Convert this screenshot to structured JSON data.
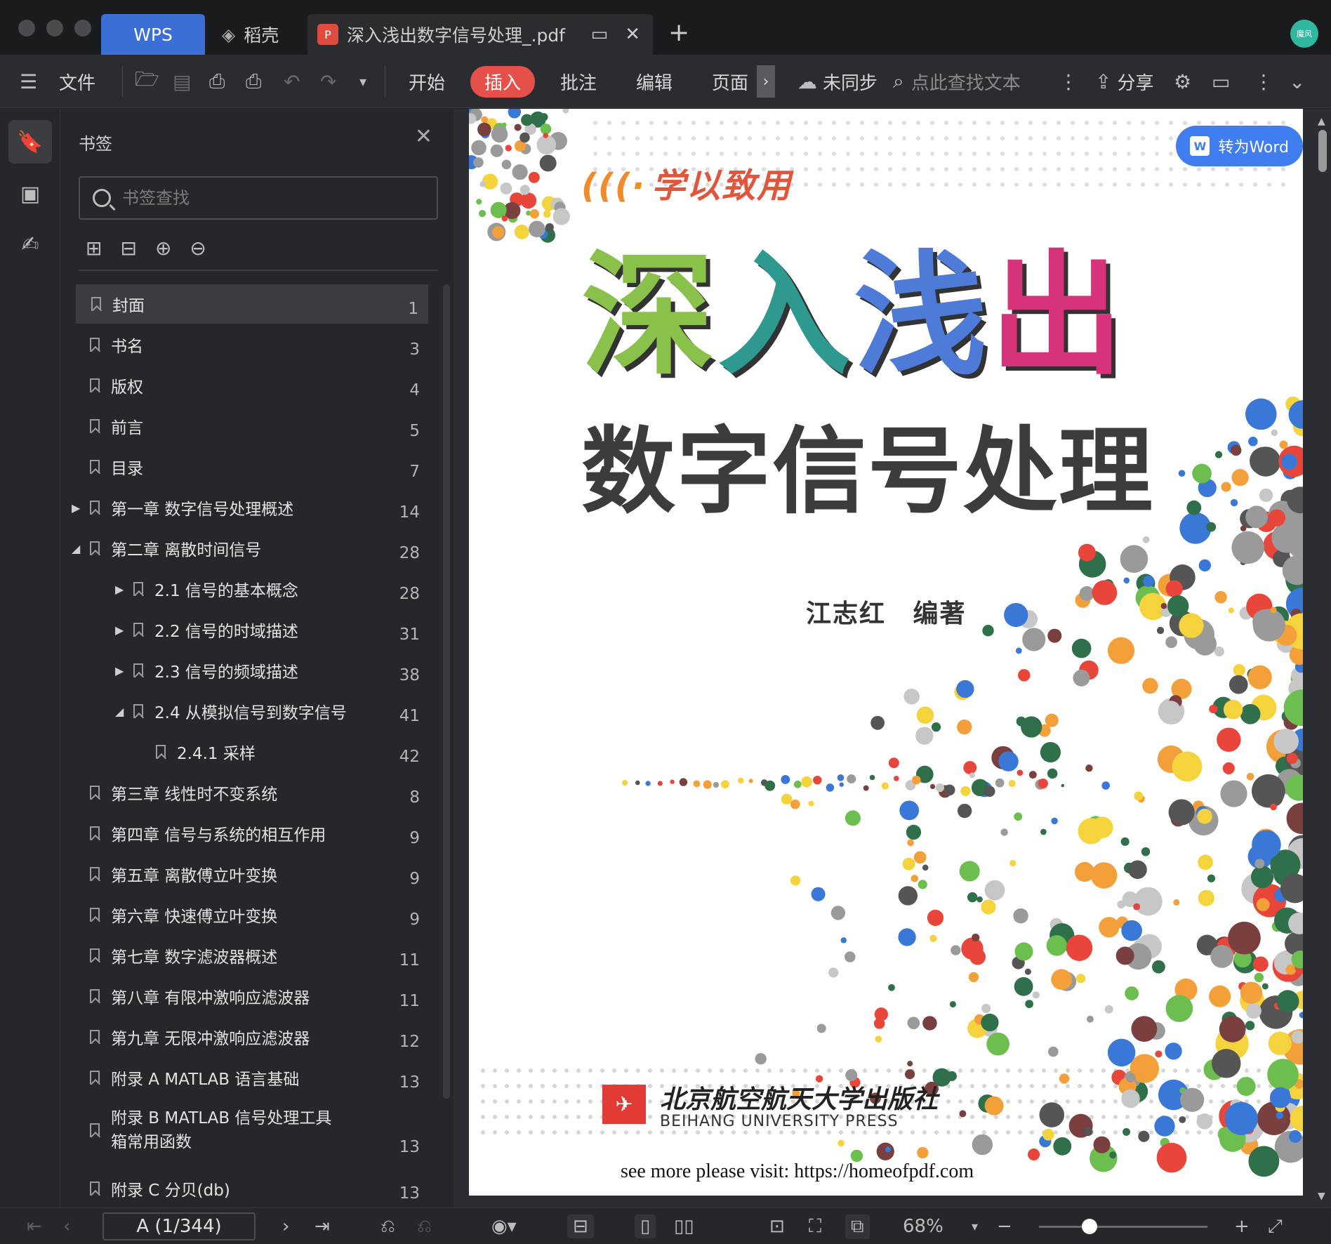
{
  "tabs": {
    "wps": "WPS",
    "daoke": "稻壳",
    "doc": "深入浅出数字信号处理_.pdf"
  },
  "avatar_text": "魔风",
  "toolbar": {
    "file": "文件",
    "start": "开始",
    "insert": "插入",
    "comment": "批注",
    "edit": "编辑",
    "page": "页面",
    "sync": "未同步",
    "find": "点此查找文本",
    "share": "分享"
  },
  "panel": {
    "title": "书签",
    "search_placeholder": "书签查找"
  },
  "bookmarks": [
    {
      "label": "封面",
      "page": "1",
      "level": 0,
      "arrow": "",
      "active": true
    },
    {
      "label": "书名",
      "page": "3",
      "level": 0,
      "arrow": ""
    },
    {
      "label": "版权",
      "page": "4",
      "level": 0,
      "arrow": ""
    },
    {
      "label": "前言",
      "page": "5",
      "level": 0,
      "arrow": ""
    },
    {
      "label": "目录",
      "page": "7",
      "level": 0,
      "arrow": ""
    },
    {
      "label": "第一章 数字信号处理概述",
      "page": "14",
      "level": 0,
      "arrow": "▶"
    },
    {
      "label": "第二章 离散时间信号",
      "page": "28",
      "level": 0,
      "arrow": "◢"
    },
    {
      "label": "2.1 信号的基本概念",
      "page": "28",
      "level": 1,
      "arrow": "▶"
    },
    {
      "label": "2.2 信号的时域描述",
      "page": "31",
      "level": 1,
      "arrow": "▶"
    },
    {
      "label": "2.3 信号的频域描述",
      "page": "38",
      "level": 1,
      "arrow": "▶"
    },
    {
      "label": "2.4 从模拟信号到数字信号",
      "page": "41",
      "level": 1,
      "arrow": "◢"
    },
    {
      "label": "2.4.1 采样",
      "page": "42",
      "level": 2,
      "arrow": ""
    },
    {
      "label": "第三章 线性时不变系统",
      "page": "8",
      "level": 0,
      "arrow": ""
    },
    {
      "label": "第四章 信号与系统的相互作用",
      "page": "9",
      "level": 0,
      "arrow": ""
    },
    {
      "label": "第五章 离散傅立叶变换",
      "page": "9",
      "level": 0,
      "arrow": ""
    },
    {
      "label": "第六章 快速傅立叶变换",
      "page": "9",
      "level": 0,
      "arrow": ""
    },
    {
      "label": "第七章 数字滤波器概述",
      "page": "11",
      "level": 0,
      "arrow": ""
    },
    {
      "label": "第八章 有限冲激响应滤波器",
      "page": "11",
      "level": 0,
      "arrow": ""
    },
    {
      "label": "第九章 无限冲激响应滤波器",
      "page": "12",
      "level": 0,
      "arrow": ""
    },
    {
      "label": "附录 A MATLAB 语言基础",
      "page": "13",
      "level": 0,
      "arrow": ""
    },
    {
      "label": "附录 B MATLAB 信号处理工具箱常用函数",
      "page": "13",
      "level": 0,
      "arrow": "",
      "wrap": true
    },
    {
      "label": "附录 C 分贝(db)",
      "page": "13",
      "level": 0,
      "arrow": ""
    }
  ],
  "to_word": "转为Word",
  "cover": {
    "brand": "学以致用",
    "title_chars": [
      "深",
      "入",
      "浅",
      "出"
    ],
    "subtitle": "数字信号处理",
    "author": "江志红 编著",
    "press_cn": "北京航空航天大学出版社",
    "press_en": "BEIHANG UNIVERSITY PRESS",
    "visit": "see more please visit: https://homeofpdf.com"
  },
  "status": {
    "page_indicator": "A (1/344)",
    "zoom": "68%",
    "zoom_fraction": 0.3
  },
  "colors": {
    "accent": "#3b6fd6",
    "insert_pill": "#e5514a",
    "to_word": "#3f7df0"
  }
}
